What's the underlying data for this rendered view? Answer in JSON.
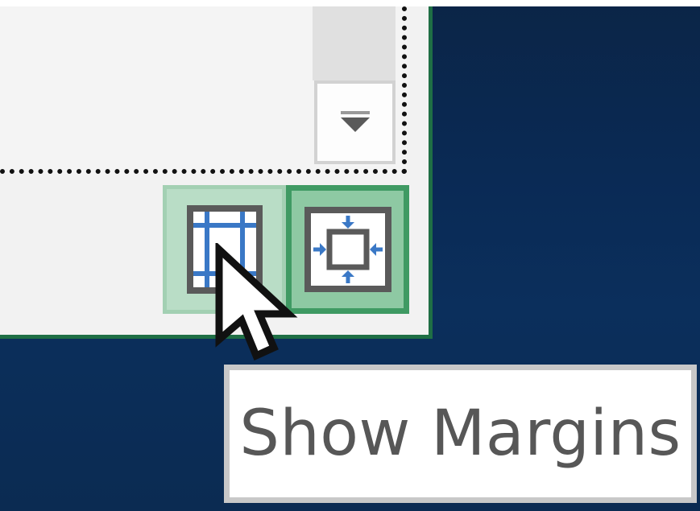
{
  "window": {
    "title": ""
  },
  "print_preview": {
    "scroll_down_icon": "triangle-down-icon",
    "buttons": [
      {
        "name": "show-margins",
        "icon": "margins-grid-icon",
        "state": "hovered"
      },
      {
        "name": "zoom-to-page",
        "icon": "zoom-to-page-icon",
        "state": "selected"
      }
    ]
  },
  "tooltip": {
    "text": "Show Margins"
  },
  "colors": {
    "background": "#0b2a55",
    "panel": "#f2f2f2",
    "panel_border": "#1f6f45",
    "hover_fill": "#b9ddc6",
    "selected_fill": "#8ec9a3",
    "icon_blue": "#3a78c6",
    "icon_gray": "#5a5a5a",
    "tooltip_text": "#575757"
  }
}
